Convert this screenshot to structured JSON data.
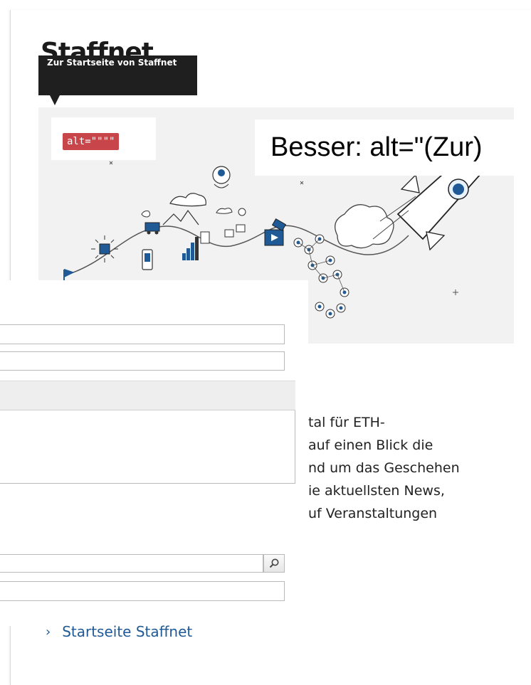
{
  "site_title": "Staffnet",
  "tooltip_text": "Zur Startseite von Staffnet",
  "alt_label": "alt=\"\"\"\"",
  "besser_text": "Besser: alt=\"(Zur)",
  "intro_lines": [
    "tal für ETH-",
    "auf einen Blick die",
    "nd um das Geschehen",
    "ie aktuellsten News,",
    "uf Veranstaltungen"
  ],
  "link_text": "Startseite Staffnet",
  "colors": {
    "alt_label_bg": "#c8464a",
    "link": "#1f5a96",
    "tooltip_bg": "#1f1f1f"
  }
}
